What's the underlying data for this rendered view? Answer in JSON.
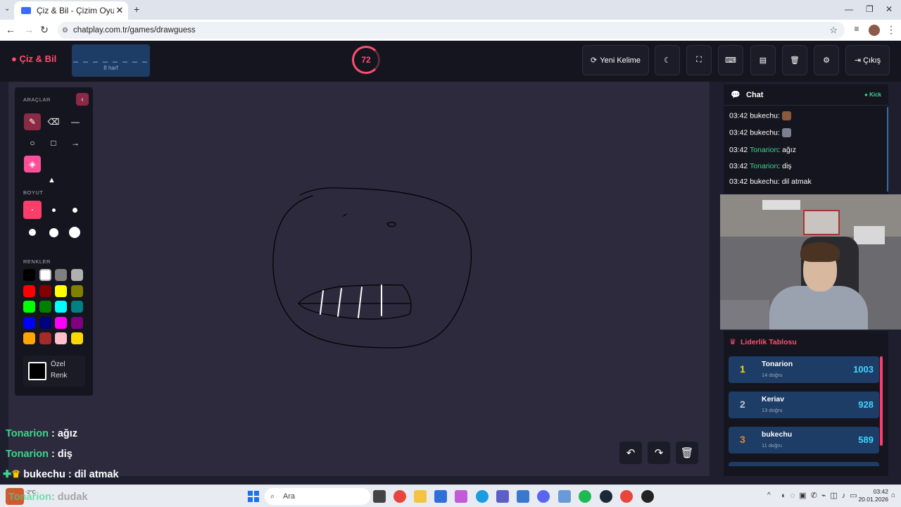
{
  "browser": {
    "tab_title": "Çiz & Bil - Çizim Oyunu",
    "url": "chatplay.com.tr/games/drawguess"
  },
  "header": {
    "logo": "Çiz & Bil",
    "word_mask": "_ _ _ _ _ _ _ _",
    "letter_count": "8 harf",
    "timer": "72",
    "new_word": "Yeni Kelime",
    "exit": "Çıkış"
  },
  "tools": {
    "section_tools": "ARAÇLAR",
    "section_size": "BOYUT",
    "section_colors": "RENKLER",
    "custom_color_line1": "Özel",
    "custom_color_line2": "Renk",
    "colors": [
      "#000000",
      "#ffffff",
      "#808080",
      "#b0b0b0",
      "#ff0000",
      "#800000",
      "#ffff00",
      "#808000",
      "#00ff00",
      "#008000",
      "#00ffff",
      "#008080",
      "#0000ff",
      "#000080",
      "#ff00ff",
      "#800080",
      "#ffa500",
      "#a52a2a",
      "#ffc0cb",
      "#ffd700"
    ]
  },
  "overlay_chat": [
    {
      "name": "Tonarion",
      "text": ": ağız"
    },
    {
      "name": "Tonarion",
      "text": ": diş"
    },
    {
      "name": "bukechu",
      "text": ": dil atmak"
    },
    {
      "name": "Tonarion",
      "text": ": dudak"
    }
  ],
  "chat": {
    "title": "Chat",
    "platform": "Kick",
    "messages": [
      {
        "time": "03:42",
        "user": "bukechu",
        "text": ":"
      },
      {
        "time": "03:42",
        "user": "bukechu",
        "text": ":"
      },
      {
        "time": "03:42",
        "user": "Tonarion",
        "text": ": ağız"
      },
      {
        "time": "03:42",
        "user": "Tonarion",
        "text": ": diş"
      },
      {
        "time": "03:42",
        "user": "bukechu",
        "text": ": dil atmak"
      }
    ]
  },
  "leaderboard": {
    "title": "Liderlik Tablosu",
    "rows": [
      {
        "rank": "1",
        "name": "Tonarion",
        "sub": "14 doğru",
        "score": "1003",
        "rank_color": "#ffd700"
      },
      {
        "rank": "2",
        "name": "Keriav",
        "sub": "13 doğru",
        "score": "928",
        "rank_color": "#c0c8d0"
      },
      {
        "rank": "3",
        "name": "bukechu",
        "sub": "11 doğru",
        "score": "589",
        "rank_color": "#e08a30"
      }
    ]
  },
  "taskbar": {
    "search": "Ara",
    "time": "03:42",
    "date": "20.01.2026",
    "weather": "-2°C"
  }
}
